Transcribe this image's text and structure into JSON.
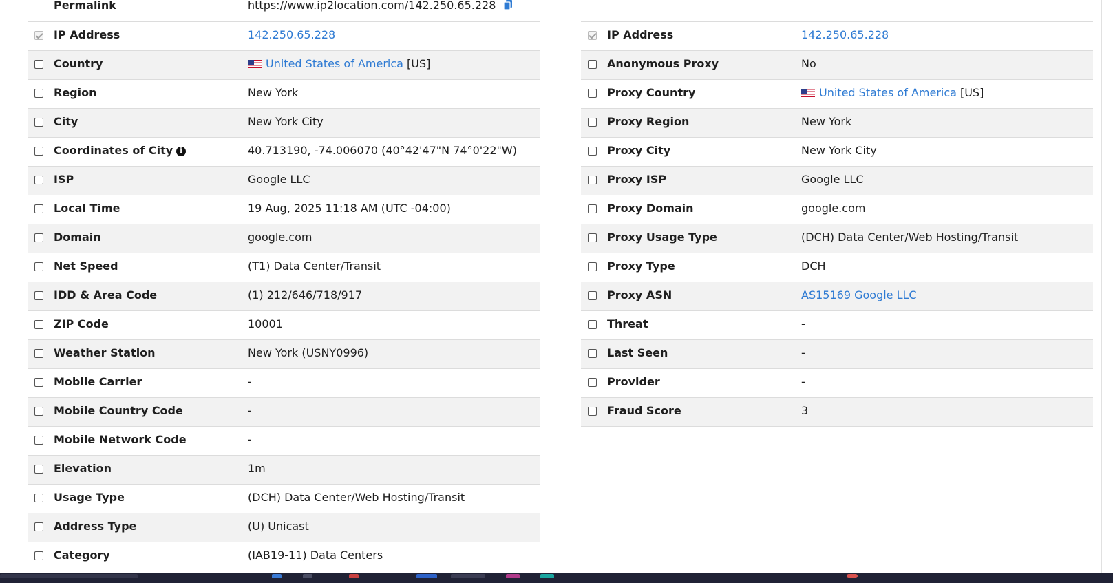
{
  "left_table": {
    "permalink": {
      "label": "Permalink",
      "value": "https://www.ip2location.com/142.250.65.228",
      "copy_icon": "copy-icon"
    },
    "rows": [
      {
        "label": "IP Address",
        "value": "142.250.65.228",
        "checked": true,
        "link": true
      },
      {
        "label": "Country",
        "value": "United States of America",
        "suffix": " [US]",
        "flag": "us-flag-icon",
        "link": true
      },
      {
        "label": "Region",
        "value": "New York"
      },
      {
        "label": "City",
        "value": "New York City"
      },
      {
        "label": "Coordinates of City",
        "value": "40.713190, -74.006070 (40°42'47\"N   74°0'22\"W)",
        "info_icon": "info-icon"
      },
      {
        "label": "ISP",
        "value": "Google LLC"
      },
      {
        "label": "Local Time",
        "value": "19 Aug, 2025 11:18 AM (UTC -04:00)"
      },
      {
        "label": "Domain",
        "value": "google.com"
      },
      {
        "label": "Net Speed",
        "value": "(T1) Data Center/Transit"
      },
      {
        "label": "IDD & Area Code",
        "value": "(1) 212/646/718/917"
      },
      {
        "label": "ZIP Code",
        "value": "10001"
      },
      {
        "label": "Weather Station",
        "value": "New York (USNY0996)"
      },
      {
        "label": "Mobile Carrier",
        "value": "-"
      },
      {
        "label": "Mobile Country Code",
        "value": "-"
      },
      {
        "label": "Mobile Network Code",
        "value": "-"
      },
      {
        "label": "Elevation",
        "value": "1m"
      },
      {
        "label": "Usage Type",
        "value": "(DCH) Data Center/Web Hosting/Transit"
      },
      {
        "label": "Address Type",
        "value": "(U) Unicast"
      },
      {
        "label": "Category",
        "value": "(IAB19-11) Data Centers"
      }
    ]
  },
  "right_table": {
    "rows": [
      {
        "label": "IP Address",
        "value": "142.250.65.228",
        "checked": true,
        "link": true
      },
      {
        "label": "Anonymous Proxy",
        "value": "No"
      },
      {
        "label": "Proxy Country",
        "value": "United States of America",
        "suffix": " [US]",
        "flag": "us-flag-icon",
        "link": true
      },
      {
        "label": "Proxy Region",
        "value": "New York"
      },
      {
        "label": "Proxy City",
        "value": "New York City"
      },
      {
        "label": "Proxy ISP",
        "value": "Google LLC"
      },
      {
        "label": "Proxy Domain",
        "value": "google.com"
      },
      {
        "label": "Proxy Usage Type",
        "value": "(DCH) Data Center/Web Hosting/Transit"
      },
      {
        "label": "Proxy Type",
        "value": "DCH"
      },
      {
        "label": "Proxy ASN",
        "value": "AS15169 Google LLC",
        "link": true
      },
      {
        "label": "Threat",
        "value": "-"
      },
      {
        "label": "Last Seen",
        "value": "-"
      },
      {
        "label": "Provider",
        "value": "-"
      },
      {
        "label": "Fraud Score",
        "value": "3"
      }
    ]
  },
  "colors": {
    "link": "#2f7bd3",
    "row_alt": "#f2f2f2",
    "taskbar": "#202235"
  }
}
